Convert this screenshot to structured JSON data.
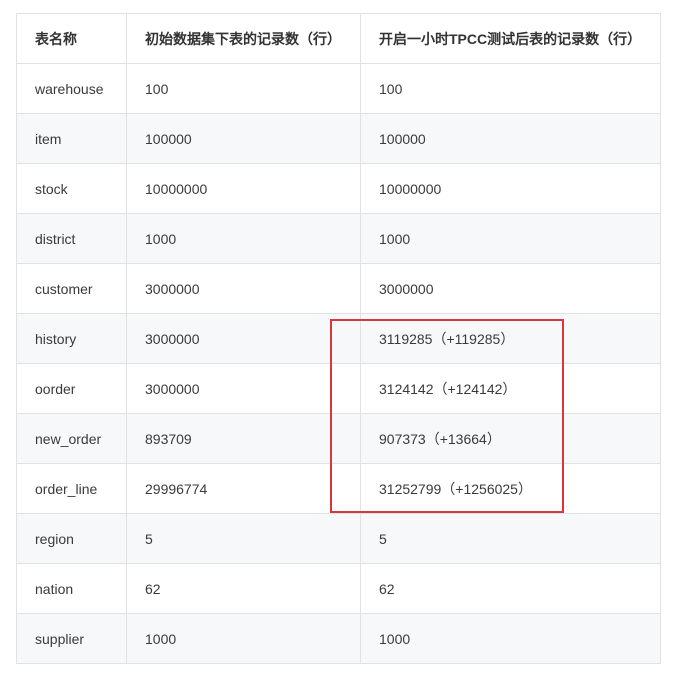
{
  "table": {
    "headers": [
      "表名称",
      "初始数据集下表的记录数（行）",
      "开启一小时TPCC测试后表的记录数（行）"
    ],
    "rows": [
      [
        "warehouse",
        "100",
        "100"
      ],
      [
        "item",
        "100000",
        "100000"
      ],
      [
        "stock",
        "10000000",
        "10000000"
      ],
      [
        "district",
        "1000",
        "1000"
      ],
      [
        "customer",
        "3000000",
        "3000000"
      ],
      [
        "history",
        "3000000",
        "3119285（+119285）"
      ],
      [
        "oorder",
        "3000000",
        "3124142（+124142）"
      ],
      [
        "new_order",
        "893709",
        "907373（+13664）"
      ],
      [
        "order_line",
        "29996774",
        "31252799（+1256025）"
      ],
      [
        "region",
        "5",
        "5"
      ],
      [
        "nation",
        "62",
        "62"
      ],
      [
        "supplier",
        "1000",
        "1000"
      ]
    ]
  },
  "highlight": {
    "color": "#d9363e",
    "rows": [
      "history",
      "oorder",
      "new_order",
      "order_line"
    ]
  }
}
